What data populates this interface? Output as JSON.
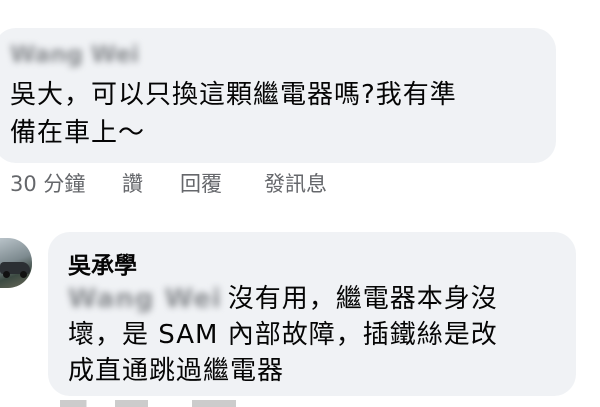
{
  "comment1": {
    "author": "Wang Wei",
    "line1": "吳大，可以只換這顆繼電器嗎?我有準",
    "line2": "備在車上～",
    "actions": {
      "time": "30 分鐘",
      "like": "讚",
      "reply": "回覆",
      "message": "發訊息"
    }
  },
  "comment2": {
    "author": "吳承學",
    "mention": "Wang Wei",
    "line1": "沒有用，繼電器本身沒",
    "line2": "壞，是 SAM 內部故障，插鐵絲是改",
    "line3": "成直通跳過繼電器"
  }
}
